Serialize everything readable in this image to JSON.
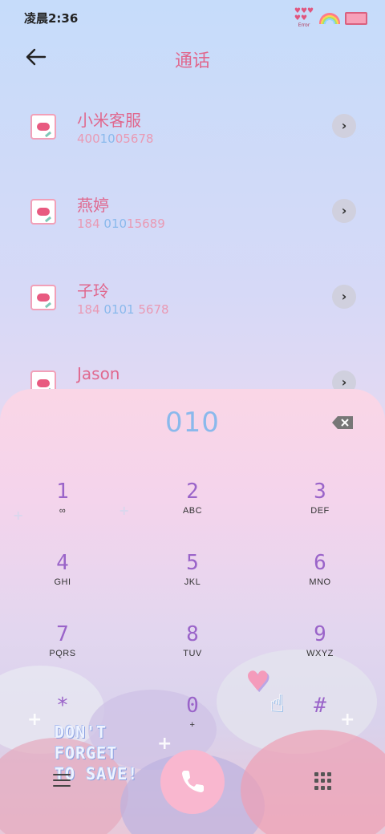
{
  "status": {
    "time": "凌晨2:36",
    "error_label": "Error"
  },
  "header": {
    "title": "通话"
  },
  "contacts": [
    {
      "name": "小米客服",
      "number_a": "400",
      "number_hl": "10",
      "number_b": "05678"
    },
    {
      "name": "燕婷",
      "number_a": "184 ",
      "number_hl": "010",
      "number_b": "15689"
    },
    {
      "name": "子玲",
      "number_a": "184 ",
      "number_hl": "0101",
      "number_b": " 5678"
    },
    {
      "name": "Jason",
      "number_a": "",
      "number_hl": "",
      "number_b": ""
    }
  ],
  "dialer": {
    "number": "010",
    "keys": [
      {
        "digit": "1",
        "letters": "∞"
      },
      {
        "digit": "2",
        "letters": "ABC"
      },
      {
        "digit": "3",
        "letters": "DEF"
      },
      {
        "digit": "4",
        "letters": "GHI"
      },
      {
        "digit": "5",
        "letters": "JKL"
      },
      {
        "digit": "6",
        "letters": "MNO"
      },
      {
        "digit": "7",
        "letters": "PQRS"
      },
      {
        "digit": "8",
        "letters": "TUV"
      },
      {
        "digit": "9",
        "letters": "WXYZ"
      },
      {
        "digit": "*",
        "letters": ""
      },
      {
        "digit": "0",
        "letters": "+"
      },
      {
        "digit": "#",
        "letters": ""
      }
    ],
    "decor_text_1": "DON'T",
    "decor_text_2": "FORGET",
    "decor_text_3": "TO SAVE!"
  },
  "colors": {
    "accent_pink": "#e0688e",
    "number_blue": "#8ab9ec",
    "key_purple": "#9a64c9",
    "call_button": "#f9b7cf"
  }
}
